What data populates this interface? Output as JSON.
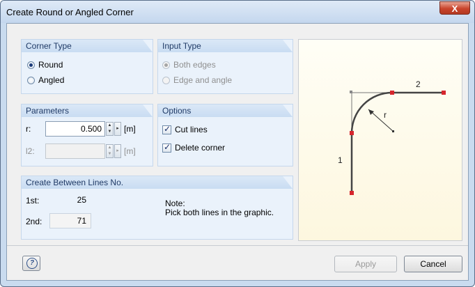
{
  "window": {
    "title": "Create Round or Angled Corner",
    "close_label": "X"
  },
  "corner_type": {
    "title": "Corner Type",
    "options": [
      {
        "label": "Round",
        "checked": true
      },
      {
        "label": "Angled",
        "checked": false
      }
    ]
  },
  "input_type": {
    "title": "Input Type",
    "options": [
      {
        "label": "Both edges",
        "checked": true,
        "disabled": true
      },
      {
        "label": "Edge and angle",
        "checked": false,
        "disabled": true
      }
    ]
  },
  "parameters": {
    "title": "Parameters",
    "r": {
      "label": "r:",
      "value": "0.500",
      "unit": "[m]"
    },
    "l2": {
      "label": "l2:",
      "value": "",
      "unit": "[m]"
    }
  },
  "options": {
    "title": "Options",
    "cut_lines": {
      "label": "Cut lines",
      "checked": true
    },
    "delete_corner": {
      "label": "Delete corner",
      "checked": true
    }
  },
  "between_lines": {
    "title": "Create Between Lines No.",
    "first": {
      "label": "1st:",
      "value": "25"
    },
    "second": {
      "label": "2nd:",
      "value": "71"
    },
    "note_title": "Note:",
    "note_text": "Pick both lines in the graphic."
  },
  "diagram": {
    "label_1": "1",
    "label_2": "2",
    "label_r": "r"
  },
  "footer": {
    "apply_label": "Apply",
    "cancel_label": "Cancel",
    "help_glyph": "?"
  },
  "colors": {
    "accent": "#1f3a66",
    "close": "#c9442c",
    "line": "#444444",
    "point": "#d6262d"
  }
}
